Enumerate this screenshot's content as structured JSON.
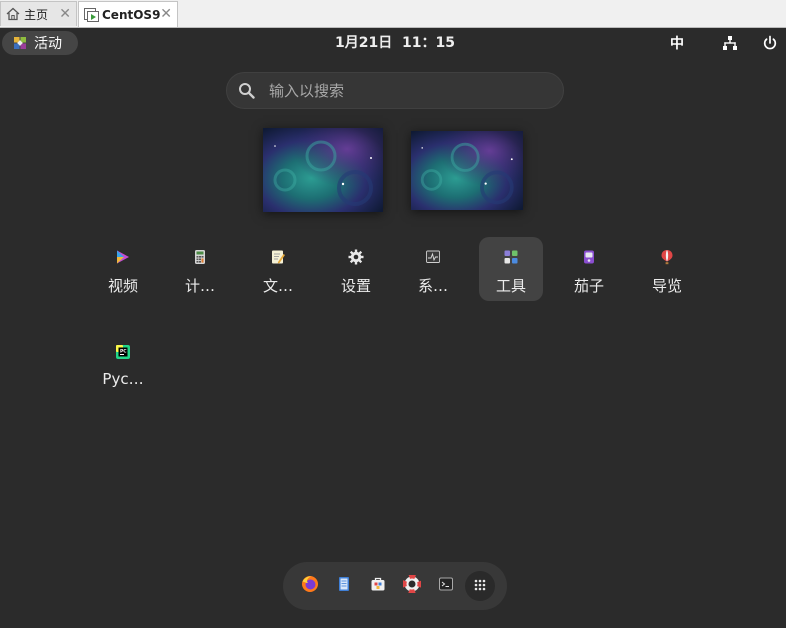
{
  "tabs": [
    {
      "label": "主页",
      "icon": "home-icon"
    },
    {
      "label": "CentOS9",
      "icon": "vm-icon"
    }
  ],
  "topbar": {
    "activities_label": "活动",
    "date": "1月21日",
    "time": "11：15",
    "input_method": "中",
    "network_icon": "network-icon",
    "power_icon": "power-icon"
  },
  "search": {
    "placeholder": "输入以搜索",
    "value": ""
  },
  "apps": [
    {
      "label": "视频",
      "icon": "video-icon",
      "selected": false
    },
    {
      "label": "计…",
      "icon": "calculator-icon",
      "selected": false
    },
    {
      "label": "文…",
      "icon": "text-editor-icon",
      "selected": false
    },
    {
      "label": "设置",
      "icon": "settings-gear-icon",
      "selected": false
    },
    {
      "label": "系…",
      "icon": "system-monitor-icon",
      "selected": false
    },
    {
      "label": "工具",
      "icon": "utilities-folder-icon",
      "selected": true
    },
    {
      "label": "茄子",
      "icon": "cheese-camera-icon",
      "selected": false
    },
    {
      "label": "导览",
      "icon": "tour-balloon-icon",
      "selected": false
    },
    {
      "label": "Pyc…",
      "icon": "pycharm-icon",
      "selected": false
    }
  ],
  "dash": [
    {
      "name": "firefox-icon"
    },
    {
      "name": "files-icon"
    },
    {
      "name": "software-icon"
    },
    {
      "name": "help-icon"
    },
    {
      "name": "terminal-icon"
    },
    {
      "name": "show-apps-grid-icon"
    }
  ],
  "colors": {
    "background": "#2b2b2b",
    "selected_tile": "#434343",
    "dash_bg": "#383838"
  }
}
